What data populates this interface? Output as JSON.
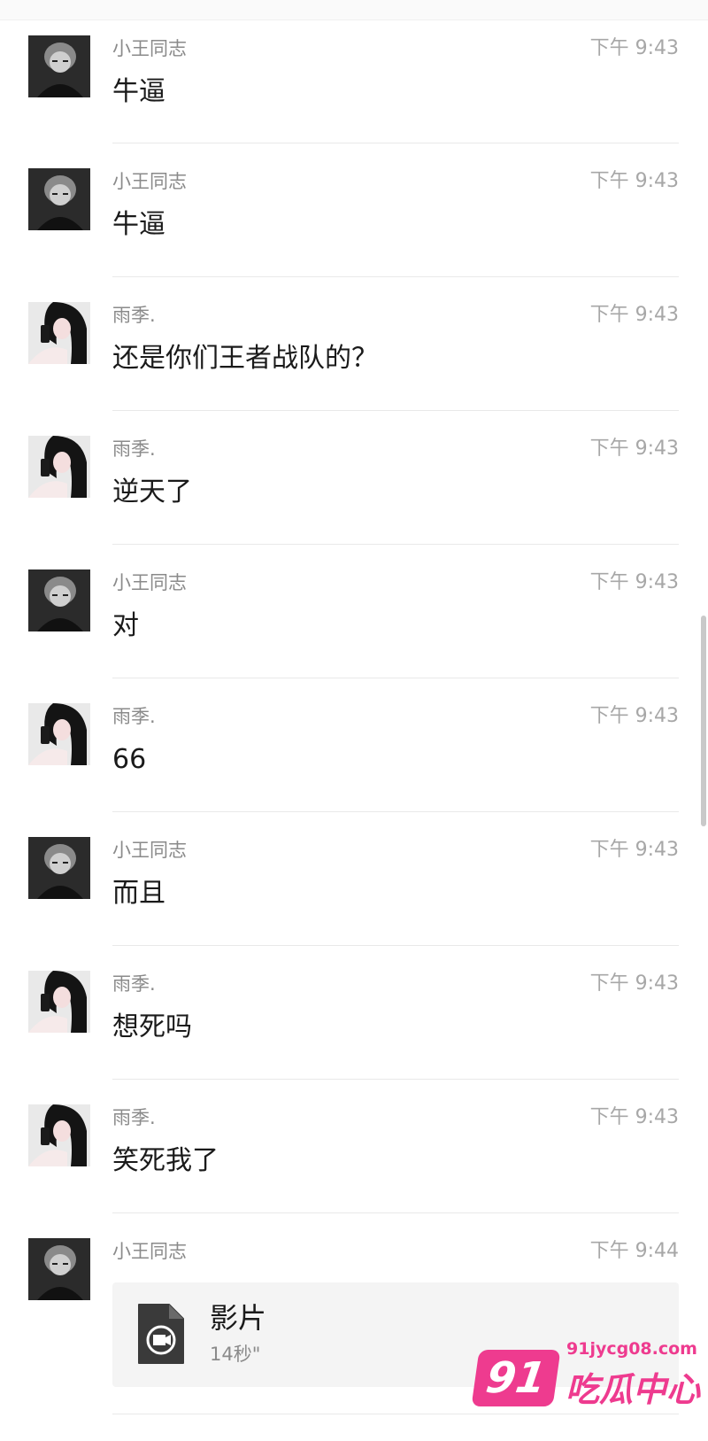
{
  "messages": [
    {
      "sender": "小王同志",
      "avatar": "avatar-xiaowang",
      "time": "下午 9:43",
      "text": "牛逼"
    },
    {
      "sender": "小王同志",
      "avatar": "avatar-xiaowang",
      "time": "下午 9:43",
      "text": "牛逼"
    },
    {
      "sender": "雨季.",
      "avatar": "avatar-yuji",
      "time": "下午 9:43",
      "text": "还是你们王者战队的？"
    },
    {
      "sender": "雨季.",
      "avatar": "avatar-yuji",
      "time": "下午 9:43",
      "text": "逆天了"
    },
    {
      "sender": "小王同志",
      "avatar": "avatar-xiaowang",
      "time": "下午 9:43",
      "text": "对"
    },
    {
      "sender": "雨季.",
      "avatar": "avatar-yuji",
      "time": "下午 9:43",
      "text": "66"
    },
    {
      "sender": "小王同志",
      "avatar": "avatar-xiaowang",
      "time": "下午 9:43",
      "text": "而且"
    },
    {
      "sender": "雨季.",
      "avatar": "avatar-yuji",
      "time": "下午 9:43",
      "text": "想死吗"
    },
    {
      "sender": "雨季.",
      "avatar": "avatar-yuji",
      "time": "下午 9:43",
      "text": "笑死我了"
    },
    {
      "sender": "小王同志",
      "avatar": "avatar-xiaowang",
      "time": "下午 9:44",
      "attachment": {
        "name": "影片",
        "meta": "14秒\"",
        "icon": "video-file-icon"
      }
    }
  ],
  "watermark": {
    "badge": "91",
    "url": "91jycg08.com",
    "name": "吃瓜中心",
    "color": "#ee3b8f"
  }
}
